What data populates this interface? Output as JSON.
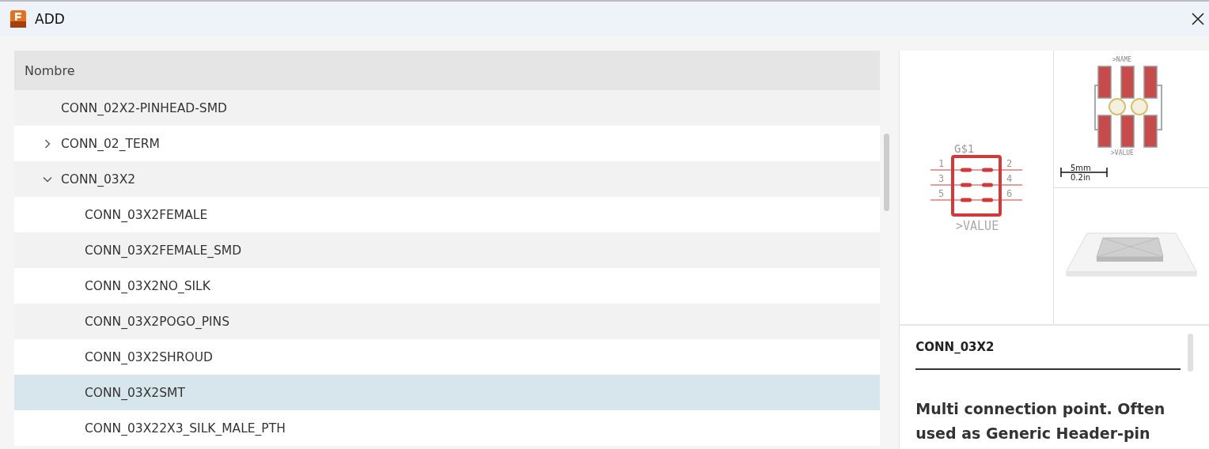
{
  "window": {
    "title": "ADD"
  },
  "table": {
    "columns": [
      "Nombre"
    ],
    "rows": [
      {
        "label": "CONN_02X2-PINHEAD-SMD",
        "selected": false
      },
      {
        "label": "CONN_02_TERM",
        "selected": false,
        "expanded": false
      },
      {
        "label": "CONN_03X2",
        "selected": false,
        "expanded": true,
        "children": [
          {
            "label": "CONN_03X2FEMALE",
            "selected": false
          },
          {
            "label": "CONN_03X2FEMALE_SMD",
            "selected": false
          },
          {
            "label": "CONN_03X2NO_SILK",
            "selected": false
          },
          {
            "label": "CONN_03X2POGO_PINS",
            "selected": false
          },
          {
            "label": "CONN_03X2SHROUD",
            "selected": false
          },
          {
            "label": "CONN_03X2SMT",
            "selected": true
          },
          {
            "label": "CONN_03X22X3_SILK_MALE_PTH",
            "selected": false
          }
        ]
      }
    ]
  },
  "preview": {
    "symbol": {
      "name": "G$1",
      "pins": [
        "1",
        "2",
        "3",
        "4",
        "5",
        "6"
      ],
      "value": ">VALUE"
    },
    "footprint": {
      "name": ">NAME",
      "value": ">VALUE",
      "scale": [
        "5mm",
        "0.2in"
      ]
    }
  },
  "description": {
    "title": "CONN_03X2",
    "text": "Multi connection point. Often used as Generic Header-pin"
  }
}
